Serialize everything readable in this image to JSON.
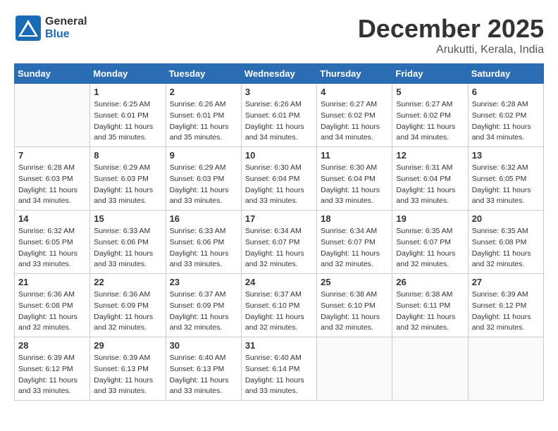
{
  "header": {
    "logo_general": "General",
    "logo_blue": "Blue",
    "month": "December 2025",
    "location": "Arukutti, Kerala, India"
  },
  "days_of_week": [
    "Sunday",
    "Monday",
    "Tuesday",
    "Wednesday",
    "Thursday",
    "Friday",
    "Saturday"
  ],
  "weeks": [
    [
      {
        "day": "",
        "sunrise": "",
        "sunset": "",
        "daylight": ""
      },
      {
        "day": "1",
        "sunrise": "Sunrise: 6:25 AM",
        "sunset": "Sunset: 6:01 PM",
        "daylight": "Daylight: 11 hours and 35 minutes."
      },
      {
        "day": "2",
        "sunrise": "Sunrise: 6:26 AM",
        "sunset": "Sunset: 6:01 PM",
        "daylight": "Daylight: 11 hours and 35 minutes."
      },
      {
        "day": "3",
        "sunrise": "Sunrise: 6:26 AM",
        "sunset": "Sunset: 6:01 PM",
        "daylight": "Daylight: 11 hours and 34 minutes."
      },
      {
        "day": "4",
        "sunrise": "Sunrise: 6:27 AM",
        "sunset": "Sunset: 6:02 PM",
        "daylight": "Daylight: 11 hours and 34 minutes."
      },
      {
        "day": "5",
        "sunrise": "Sunrise: 6:27 AM",
        "sunset": "Sunset: 6:02 PM",
        "daylight": "Daylight: 11 hours and 34 minutes."
      },
      {
        "day": "6",
        "sunrise": "Sunrise: 6:28 AM",
        "sunset": "Sunset: 6:02 PM",
        "daylight": "Daylight: 11 hours and 34 minutes."
      }
    ],
    [
      {
        "day": "7",
        "sunrise": "Sunrise: 6:28 AM",
        "sunset": "Sunset: 6:03 PM",
        "daylight": "Daylight: 11 hours and 34 minutes."
      },
      {
        "day": "8",
        "sunrise": "Sunrise: 6:29 AM",
        "sunset": "Sunset: 6:03 PM",
        "daylight": "Daylight: 11 hours and 33 minutes."
      },
      {
        "day": "9",
        "sunrise": "Sunrise: 6:29 AM",
        "sunset": "Sunset: 6:03 PM",
        "daylight": "Daylight: 11 hours and 33 minutes."
      },
      {
        "day": "10",
        "sunrise": "Sunrise: 6:30 AM",
        "sunset": "Sunset: 6:04 PM",
        "daylight": "Daylight: 11 hours and 33 minutes."
      },
      {
        "day": "11",
        "sunrise": "Sunrise: 6:30 AM",
        "sunset": "Sunset: 6:04 PM",
        "daylight": "Daylight: 11 hours and 33 minutes."
      },
      {
        "day": "12",
        "sunrise": "Sunrise: 6:31 AM",
        "sunset": "Sunset: 6:04 PM",
        "daylight": "Daylight: 11 hours and 33 minutes."
      },
      {
        "day": "13",
        "sunrise": "Sunrise: 6:32 AM",
        "sunset": "Sunset: 6:05 PM",
        "daylight": "Daylight: 11 hours and 33 minutes."
      }
    ],
    [
      {
        "day": "14",
        "sunrise": "Sunrise: 6:32 AM",
        "sunset": "Sunset: 6:05 PM",
        "daylight": "Daylight: 11 hours and 33 minutes."
      },
      {
        "day": "15",
        "sunrise": "Sunrise: 6:33 AM",
        "sunset": "Sunset: 6:06 PM",
        "daylight": "Daylight: 11 hours and 33 minutes."
      },
      {
        "day": "16",
        "sunrise": "Sunrise: 6:33 AM",
        "sunset": "Sunset: 6:06 PM",
        "daylight": "Daylight: 11 hours and 33 minutes."
      },
      {
        "day": "17",
        "sunrise": "Sunrise: 6:34 AM",
        "sunset": "Sunset: 6:07 PM",
        "daylight": "Daylight: 11 hours and 32 minutes."
      },
      {
        "day": "18",
        "sunrise": "Sunrise: 6:34 AM",
        "sunset": "Sunset: 6:07 PM",
        "daylight": "Daylight: 11 hours and 32 minutes."
      },
      {
        "day": "19",
        "sunrise": "Sunrise: 6:35 AM",
        "sunset": "Sunset: 6:07 PM",
        "daylight": "Daylight: 11 hours and 32 minutes."
      },
      {
        "day": "20",
        "sunrise": "Sunrise: 6:35 AM",
        "sunset": "Sunset: 6:08 PM",
        "daylight": "Daylight: 11 hours and 32 minutes."
      }
    ],
    [
      {
        "day": "21",
        "sunrise": "Sunrise: 6:36 AM",
        "sunset": "Sunset: 6:08 PM",
        "daylight": "Daylight: 11 hours and 32 minutes."
      },
      {
        "day": "22",
        "sunrise": "Sunrise: 6:36 AM",
        "sunset": "Sunset: 6:09 PM",
        "daylight": "Daylight: 11 hours and 32 minutes."
      },
      {
        "day": "23",
        "sunrise": "Sunrise: 6:37 AM",
        "sunset": "Sunset: 6:09 PM",
        "daylight": "Daylight: 11 hours and 32 minutes."
      },
      {
        "day": "24",
        "sunrise": "Sunrise: 6:37 AM",
        "sunset": "Sunset: 6:10 PM",
        "daylight": "Daylight: 11 hours and 32 minutes."
      },
      {
        "day": "25",
        "sunrise": "Sunrise: 6:38 AM",
        "sunset": "Sunset: 6:10 PM",
        "daylight": "Daylight: 11 hours and 32 minutes."
      },
      {
        "day": "26",
        "sunrise": "Sunrise: 6:38 AM",
        "sunset": "Sunset: 6:11 PM",
        "daylight": "Daylight: 11 hours and 32 minutes."
      },
      {
        "day": "27",
        "sunrise": "Sunrise: 6:39 AM",
        "sunset": "Sunset: 6:12 PM",
        "daylight": "Daylight: 11 hours and 32 minutes."
      }
    ],
    [
      {
        "day": "28",
        "sunrise": "Sunrise: 6:39 AM",
        "sunset": "Sunset: 6:12 PM",
        "daylight": "Daylight: 11 hours and 33 minutes."
      },
      {
        "day": "29",
        "sunrise": "Sunrise: 6:39 AM",
        "sunset": "Sunset: 6:13 PM",
        "daylight": "Daylight: 11 hours and 33 minutes."
      },
      {
        "day": "30",
        "sunrise": "Sunrise: 6:40 AM",
        "sunset": "Sunset: 6:13 PM",
        "daylight": "Daylight: 11 hours and 33 minutes."
      },
      {
        "day": "31",
        "sunrise": "Sunrise: 6:40 AM",
        "sunset": "Sunset: 6:14 PM",
        "daylight": "Daylight: 11 hours and 33 minutes."
      },
      {
        "day": "",
        "sunrise": "",
        "sunset": "",
        "daylight": ""
      },
      {
        "day": "",
        "sunrise": "",
        "sunset": "",
        "daylight": ""
      },
      {
        "day": "",
        "sunrise": "",
        "sunset": "",
        "daylight": ""
      }
    ]
  ]
}
